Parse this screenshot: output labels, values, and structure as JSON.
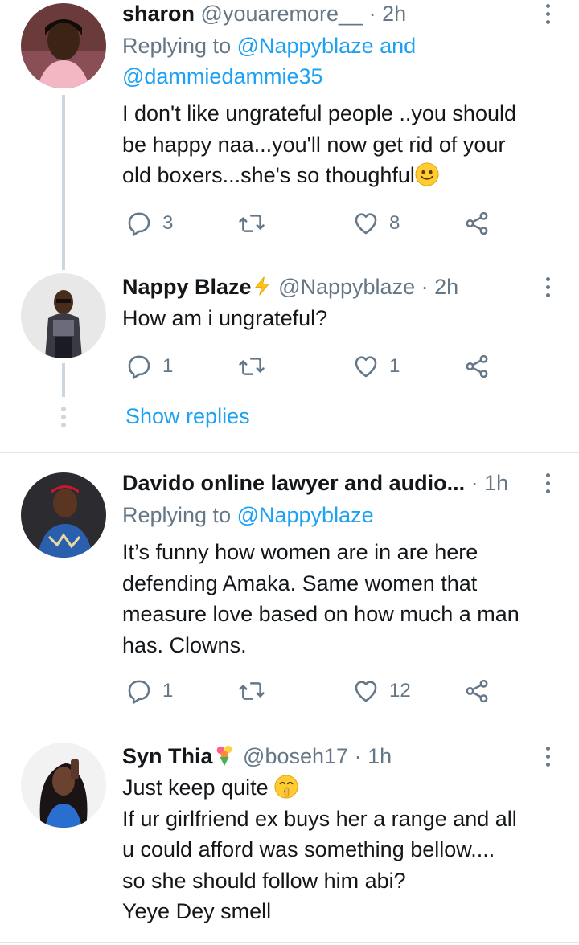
{
  "tweets": [
    {
      "name": "sharon",
      "handle": "@youaremore__",
      "sep": "·",
      "time": "2h",
      "replying_prefix": "Replying to ",
      "replying_to_1": "@Nappyblaze",
      "replying_and": " and",
      "replying_to_2": "@dammiedammie35",
      "lines": [
        "I don't like ungrateful people ..you should",
        "be happy naa...you'll now get rid of your",
        "old boxers...she's so thoughful"
      ],
      "text_emoji": "slightly-smiling-face",
      "replies": "3",
      "retweets": "",
      "likes": "8"
    },
    {
      "name": "Nappy Blaze",
      "name_emoji": "lightning-bolt",
      "handle": "@Nappyblaze",
      "sep": "·",
      "time": "2h",
      "lines": [
        "How am i ungrateful?"
      ],
      "replies": "1",
      "retweets": "",
      "likes": "1"
    },
    {
      "name": "Davido online lawyer and audio...",
      "sep": "·",
      "time": "1h",
      "replying_prefix": "Replying to ",
      "replying_to_1": "@Nappyblaze",
      "lines": [
        "It’s funny how women are in are here",
        "defending Amaka. Same women that",
        "measure love based on how much a man",
        "has. Clowns."
      ],
      "replies": "1",
      "retweets": "",
      "likes": "12"
    },
    {
      "name": "Syn Thia",
      "name_emoji": "bouquet",
      "handle": "@boseh17",
      "sep": "·",
      "time": "1h",
      "line1": "Just keep quite",
      "line1_emoji": "shushing-face",
      "lines": [
        "If ur girlfriend ex buys her a range and all",
        "u could afford was something bellow....",
        "so she should follow him abi?",
        "Yeye Dey smell"
      ]
    }
  ],
  "show_replies": "Show replies",
  "colors": {
    "accent": "#1da1f2",
    "secondary_text": "#657786",
    "primary_text": "#14171a",
    "thread_line": "#ccd6dd",
    "divider": "#e1e8ed"
  },
  "icons": [
    "reply-icon",
    "retweet-icon",
    "like-icon",
    "share-icon",
    "more-icon"
  ]
}
